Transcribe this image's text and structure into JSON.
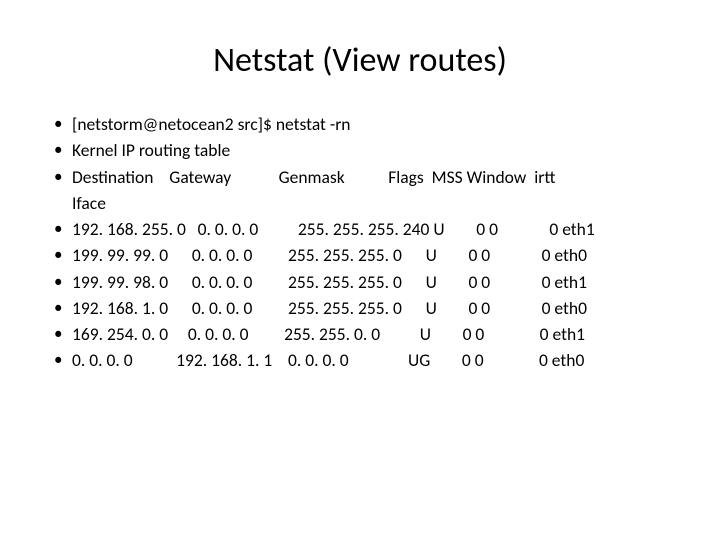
{
  "title": "Netstat (View routes)",
  "lines": [
    "[netstorm@netocean2 src]$ netstat -rn",
    "Kernel IP routing table",
    "Destination    Gateway            Genmask           Flags  MSS Window  irtt  \nIface",
    "192. 168. 255. 0   0. 0. 0. 0          255. 255. 255. 240 U        0 0             0 eth1",
    "199. 99. 99. 0      0. 0. 0. 0         255. 255. 255. 0      U        0 0             0 eth0",
    "199. 99. 98. 0      0. 0. 0. 0         255. 255. 255. 0      U        0 0             0 eth1",
    "192. 168. 1. 0      0. 0. 0. 0         255. 255. 255. 0      U        0 0             0 eth0",
    "169. 254. 0. 0     0. 0. 0. 0         255. 255. 0. 0          U        0 0              0 eth1",
    "0. 0. 0. 0           192. 168. 1. 1    0. 0. 0. 0               UG        0 0              0 eth0"
  ]
}
